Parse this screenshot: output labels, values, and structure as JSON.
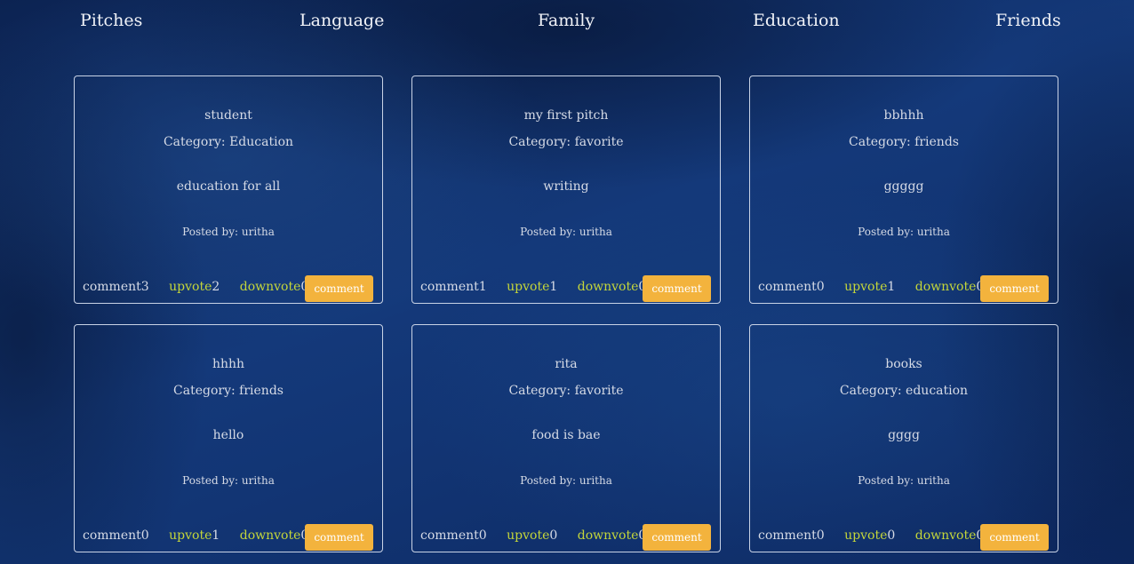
{
  "nav": {
    "brand": "Pitches",
    "links": [
      "Language",
      "Family",
      "Education",
      "Friends"
    ]
  },
  "labels": {
    "category_prefix": "Category: ",
    "posted_prefix": "Posted by: ",
    "comment_word": "comment",
    "upvote_word": "upvote",
    "downvote_word": "downvote",
    "comment_button": "comment"
  },
  "colors": {
    "vote_link": "#c4d63a",
    "button": "#f3b33d",
    "background": "#0f2a5e"
  },
  "pitches": [
    {
      "title": "student",
      "category": "Category: Education",
      "body": "education for all",
      "author": "Posted by: uritha",
      "comments": "3",
      "upvotes": "2",
      "downvotes": "0"
    },
    {
      "title": "my first pitch",
      "category": "Category: favorite",
      "body": "writing",
      "author": "Posted by: uritha",
      "comments": "1",
      "upvotes": "1",
      "downvotes": "0"
    },
    {
      "title": "bbhhh",
      "category": "Category: friends",
      "body": "ggggg",
      "author": "Posted by: uritha",
      "comments": "0",
      "upvotes": "1",
      "downvotes": "0"
    },
    {
      "title": "hhhh",
      "category": "Category: friends",
      "body": "hello",
      "author": "Posted by: uritha",
      "comments": "0",
      "upvotes": "1",
      "downvotes": "0"
    },
    {
      "title": "rita",
      "category": "Category: favorite",
      "body": "food is bae",
      "author": "Posted by: uritha",
      "comments": "0",
      "upvotes": "0",
      "downvotes": "0"
    },
    {
      "title": "books",
      "category": "Category: education",
      "body": "gggg",
      "author": "Posted by: uritha",
      "comments": "0",
      "upvotes": "0",
      "downvotes": "0"
    }
  ]
}
